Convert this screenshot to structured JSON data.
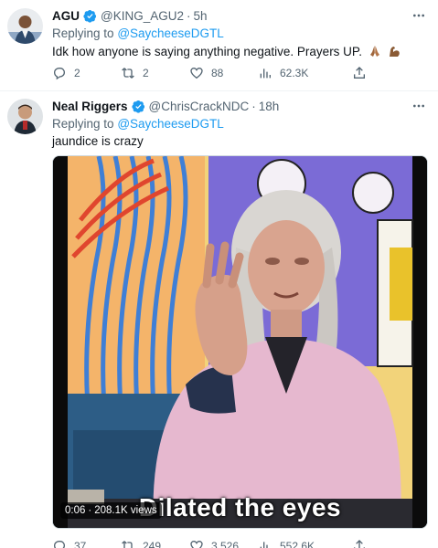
{
  "tweets": [
    {
      "name": "AGU",
      "handle": "@KING_AGU2",
      "time": "5h",
      "replying_prefix": "Replying to",
      "replying_to": "@SaycheeseDGTL",
      "text": "Idk how anyone is saying anything negative. Prayers UP.",
      "emoji_icons": [
        "folded-hands-icon",
        "flexed-biceps-icon"
      ],
      "stats": {
        "replies": "2",
        "retweets": "2",
        "likes": "88",
        "views": "62.3K"
      }
    },
    {
      "name": "Neal Riggers",
      "handle": "@ChrisCrackNDC",
      "time": "18h",
      "replying_prefix": "Replying to",
      "replying_to": "@SaycheeseDGTL",
      "text": "jaundice is crazy",
      "video": {
        "caption": "Dilated the eyes",
        "duration": "0:06",
        "views": "208.1K views"
      },
      "stats": {
        "replies": "37",
        "retweets": "249",
        "likes": "3,526",
        "views": "552.6K"
      }
    }
  ],
  "colors": {
    "link": "#1d9bf0",
    "secondary_text": "#536471",
    "verified": "#1d9bf0",
    "divider": "#eff3f4"
  },
  "icons": {
    "separator": "·",
    "verified": "verified-badge-icon",
    "more": "more-icon",
    "reply": "reply-icon",
    "retweet": "retweet-icon",
    "like": "like-icon",
    "views": "views-icon",
    "share": "share-icon"
  }
}
